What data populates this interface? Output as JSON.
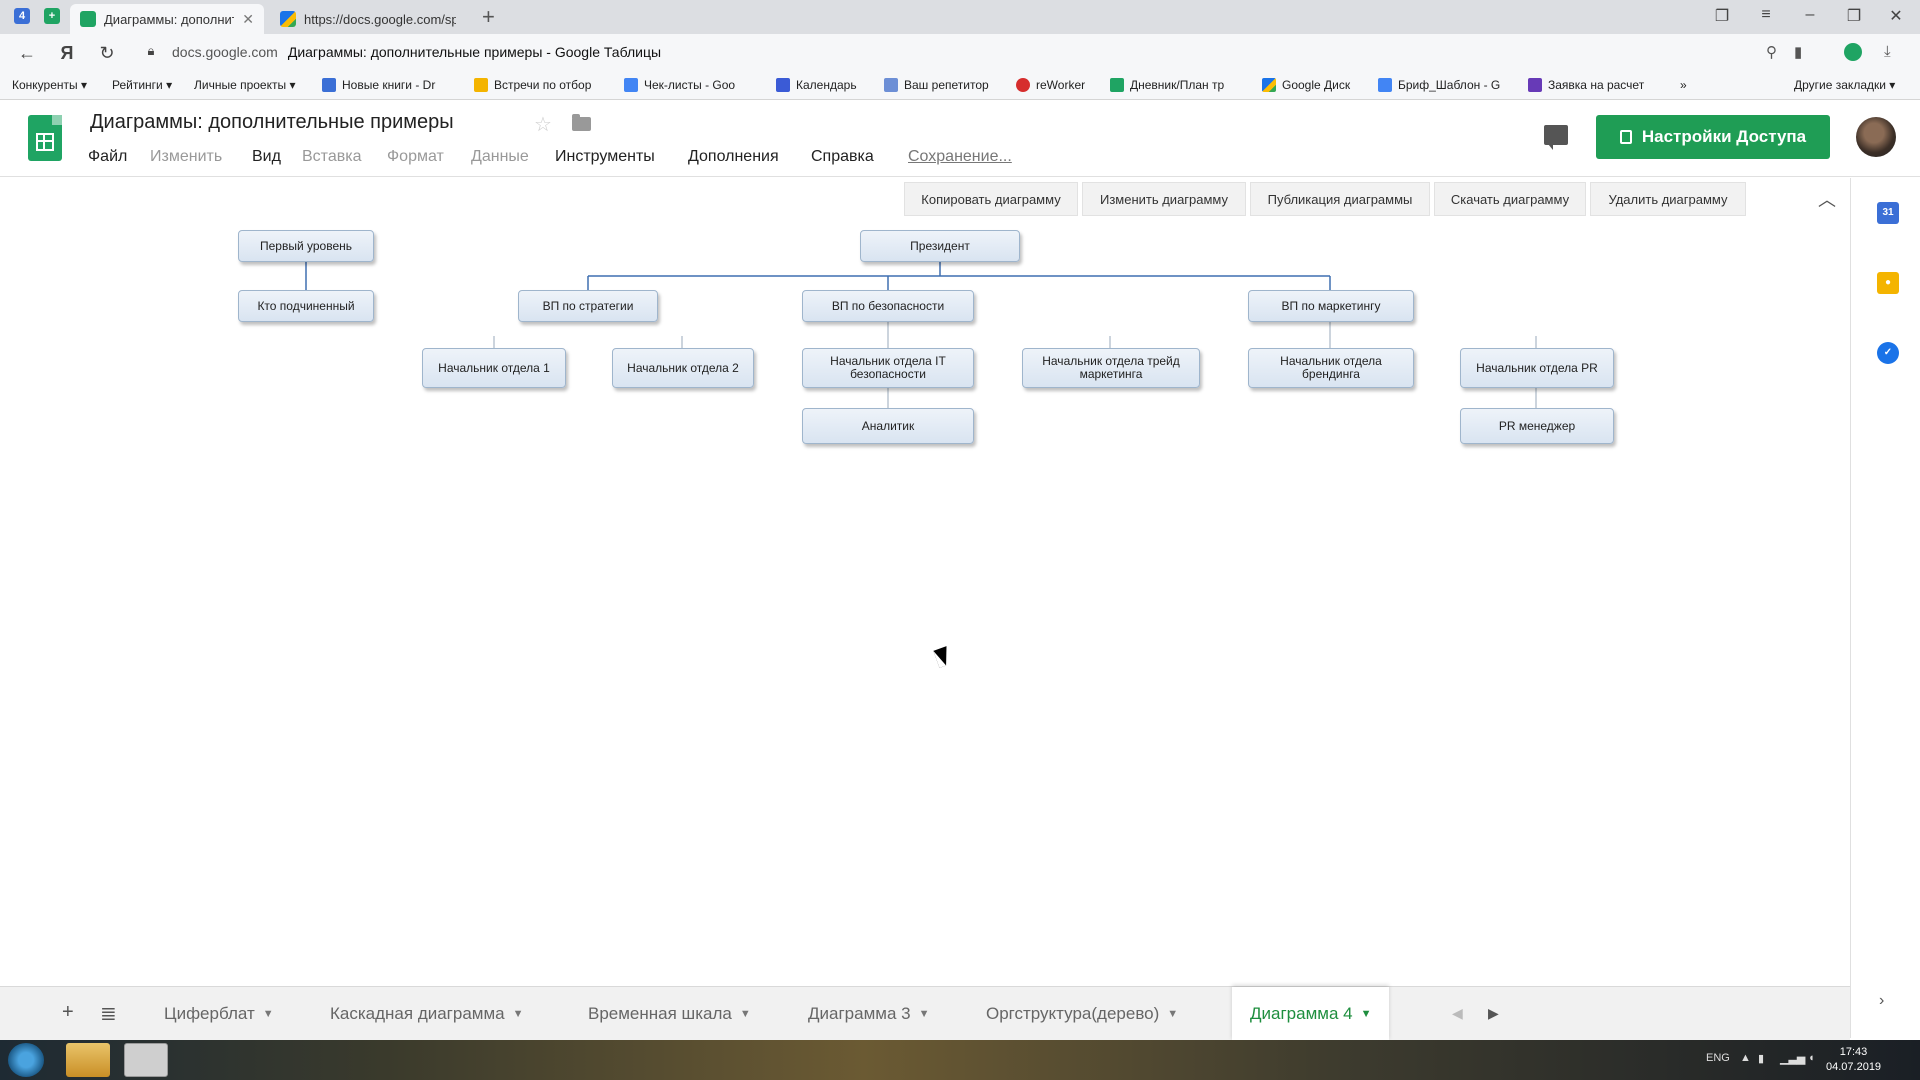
{
  "browser": {
    "tabs": [
      {
        "label": "Диаграммы: дополнител",
        "active": true
      },
      {
        "label": "https://docs.google.com/sp",
        "active": false
      }
    ],
    "url_domain": "docs.google.com",
    "url_title": "Диаграммы: дополнительные примеры - Google Таблицы",
    "bookmarks": [
      "Конкуренты ▾",
      "Рейтинги ▾",
      "Личные проекты ▾",
      "Новые книги - Dr",
      "Встречи по отбор",
      "Чек-листы - Goo",
      "Календарь",
      "Ваш репетитор",
      "reWorker",
      "Дневник/План тр",
      "Google Диск",
      "Бриф_Шаблон - G",
      "Заявка на расчет",
      "»"
    ],
    "other_bookmarks": "Другие закладки ▾"
  },
  "app": {
    "title": "Диаграммы: дополнительные примеры",
    "menu": {
      "file": "Файл",
      "edit": "Изменить",
      "view": "Вид",
      "insert": "Вставка",
      "format": "Формат",
      "data": "Данные",
      "tools": "Инструменты",
      "addons": "Дополнения",
      "help": "Справка",
      "saving": "Сохранение..."
    },
    "share_label": "Настройки Доступа"
  },
  "chart_toolbar": {
    "copy": "Копировать диаграмму",
    "edit": "Изменить диаграмму",
    "publish": "Публикация диаграммы",
    "download": "Скачать диаграмму",
    "delete": "Удалить диаграмму"
  },
  "org_chart": {
    "legend_top": "Первый уровень",
    "legend_bottom": "Кто подчиненный",
    "president": "Президент",
    "vp_strategy": "ВП по стратегии",
    "vp_security": "ВП по безопасности",
    "vp_marketing": "ВП по маркетингу",
    "head_1": "Начальник отдела 1",
    "head_2": "Начальник отдела 2",
    "head_security_1": "Начальник отдела ІТ",
    "head_security_2": "безопасности",
    "head_trade_1": "Начальник отдела трейд",
    "head_trade_2": "маркетинга",
    "head_brand_1": "Начальник отдела",
    "head_brand_2": "брендинга",
    "head_pr": "Начальник отдела PR",
    "analyst": "Аналитик",
    "pr_manager": "PR менеджер"
  },
  "sheets": {
    "tabs": [
      "Циферблат",
      "Каскадная диаграмма",
      "Временная шкала",
      "Диаграмма 3",
      "Оргструктура(дерево)",
      "Диаграмма 4"
    ],
    "active_index": 5
  },
  "taskbar": {
    "time": "17:43",
    "date": "04.07.2019"
  }
}
